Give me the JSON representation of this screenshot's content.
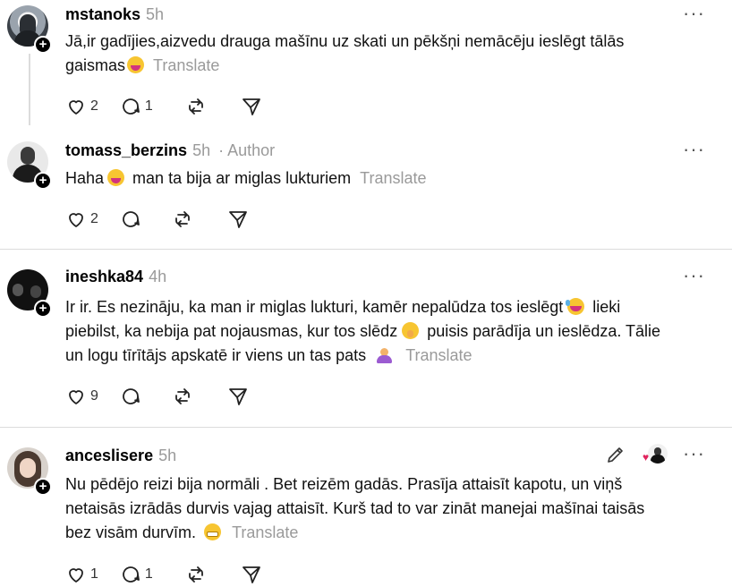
{
  "replies": [
    {
      "username": "mstanoks",
      "time": "5h",
      "author_tag": "",
      "line1": "Jā,ir gadījies,aizvedu drauga mašīnu uz skati un pēkšņi nemācēju ieslēgt tālās",
      "line2": "gaismas",
      "line3": "",
      "translate": "Translate",
      "likes": "2",
      "replies": "1"
    },
    {
      "username": "tomass_berzins",
      "time": "5h",
      "author_tag": "· Author",
      "line1a": "Haha",
      "line1b": "man ta bija ar miglas lukturiem",
      "translate": "Translate",
      "likes": "2",
      "replies": ""
    },
    {
      "username": "ineshka84",
      "time": "4h",
      "line1a": "Ir ir. Es nezināju, ka man ir miglas lukturi, kamēr nepalūdza tos ieslēgt",
      "line1b": "lieki",
      "line2a": "piebilst, ka nebija pat nojausmas, kur tos slēdz",
      "line2b": "puisis parādīja un ieslēdza. Tālie",
      "line3a": "un logu tīrītājs apskatē ir viens un tas pats",
      "translate": "Translate",
      "likes": "9",
      "replies": ""
    },
    {
      "username": "anceslisere",
      "time": "5h",
      "line1": "Nu pēdējo reizi bija normāli . Bet reizēm gadās. Prasīja attaisīt kapotu, un viņš",
      "line2": "netaisās izrādās durvis vajag attaisīt. Kurš tad to var zināt manejai mašīnai taisās",
      "line3a": "bez visām durvīm.",
      "translate": "Translate",
      "likes": "1",
      "replies": "1"
    }
  ],
  "more_label": "···",
  "icons": {
    "like": "heart-icon",
    "reply": "comment-icon",
    "repost": "repost-icon",
    "share": "send-icon",
    "edit": "pencil-icon"
  }
}
